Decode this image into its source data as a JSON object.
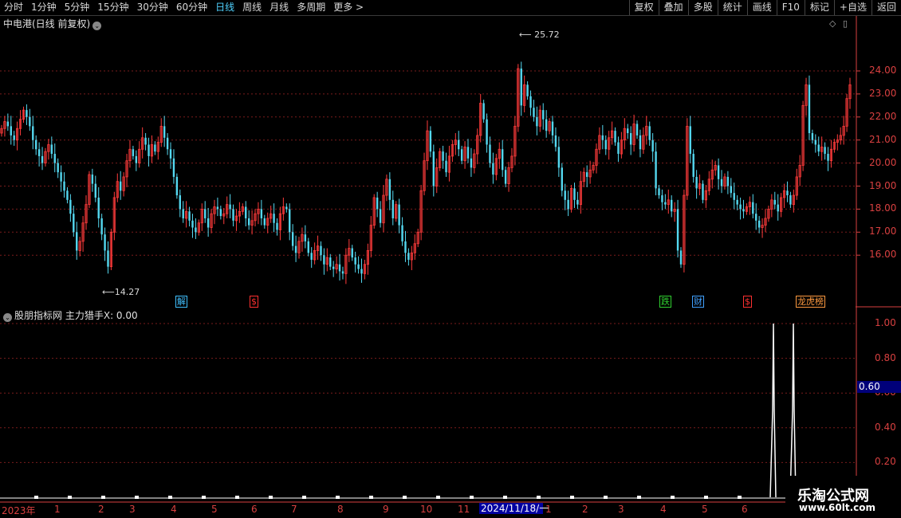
{
  "toolbar": {
    "periods": [
      "分时",
      "1分钟",
      "5分钟",
      "15分钟",
      "30分钟",
      "60分钟",
      "日线",
      "周线",
      "月线",
      "多周期",
      "更多 >"
    ],
    "active_period": "日线",
    "actions": [
      "复权",
      "叠加",
      "多股",
      "统计",
      "画线",
      "F10",
      "标记",
      "+自选",
      "返回"
    ]
  },
  "main_chart": {
    "title": "中电港(日线 前复权)",
    "high_label": "25.72",
    "low_label": "14.27",
    "y_axis": [
      "24.00",
      "23.00",
      "22.00",
      "21.00",
      "20.00",
      "19.00",
      "18.00",
      "17.00",
      "16.00"
    ],
    "markers": [
      {
        "text": "解",
        "color": "#40c0ff"
      },
      {
        "text": "$",
        "color": "#ff3030"
      },
      {
        "text": "跌",
        "color": "#30d030"
      },
      {
        "text": "财",
        "color": "#40a0ff"
      },
      {
        "text": "$",
        "color": "#ff3030"
      },
      {
        "text": "龙虎榜",
        "color": "#ff9a40"
      }
    ]
  },
  "sub_chart": {
    "title": "股朋指标网",
    "indicator": "主力猎手X: 0.00",
    "y_axis": [
      "1.00",
      "0.80",
      "0.60",
      "0.40",
      "0.20"
    ],
    "cursor_value": "0.60"
  },
  "x_axis": {
    "labels": [
      "2023年",
      "1",
      "2",
      "3",
      "4",
      "5",
      "6",
      "7",
      "8",
      "9",
      "10",
      "11",
      "1",
      "2",
      "3",
      "4",
      "5",
      "6"
    ],
    "highlight": "2024/11/18/一"
  },
  "watermark": {
    "line1": "乐淘公式网",
    "line2": "www.60lt.com"
  },
  "chart_data": {
    "type": "candlestick",
    "title": "中电港(日线 前复权)",
    "ylim": [
      14.27,
      25.72
    ],
    "y_ticks": [
      16,
      17,
      18,
      19,
      20,
      21,
      22,
      23,
      24
    ],
    "closes": [
      21.5,
      21.8,
      21.6,
      21.2,
      21.0,
      21.5,
      21.9,
      22.3,
      22.0,
      21.6,
      21.0,
      20.6,
      20.3,
      20.0,
      20.5,
      20.8,
      20.4,
      20.0,
      19.6,
      19.2,
      18.8,
      18.4,
      17.8,
      17.0,
      16.2,
      16.6,
      17.4,
      18.2,
      19.5,
      19.1,
      18.5,
      17.6,
      16.9,
      16.2,
      15.5,
      17.0,
      18.5,
      19.2,
      18.8,
      19.4,
      20.1,
      20.6,
      20.3,
      20.0,
      20.6,
      21.1,
      20.8,
      20.3,
      20.8,
      20.5,
      20.9,
      21.6,
      21.1,
      20.6,
      20.2,
      19.4,
      18.6,
      18.0,
      17.6,
      17.9,
      17.5,
      17.2,
      17.0,
      17.4,
      18.0,
      17.6,
      17.2,
      17.8,
      18.1,
      18.0,
      17.7,
      17.8,
      18.2,
      18.0,
      17.5,
      17.7,
      17.9,
      18.1,
      17.6,
      17.3,
      17.5,
      17.8,
      18.0,
      17.6,
      17.3,
      17.6,
      17.8,
      17.4,
      17.1,
      17.8,
      18.1,
      18.0,
      17.0,
      16.4,
      16.1,
      16.6,
      16.9,
      16.6,
      16.1,
      15.8,
      16.2,
      16.4,
      16.0,
      15.6,
      15.9,
      15.5,
      15.4,
      15.6,
      15.3,
      15.2,
      16.0,
      16.3,
      15.9,
      15.6,
      15.4,
      15.2,
      15.6,
      16.2,
      17.3,
      18.5,
      18.0,
      17.4,
      18.6,
      19.3,
      18.4,
      17.6,
      18.2,
      17.3,
      16.6,
      16.1,
      15.8,
      16.1,
      16.5,
      17.0,
      18.8,
      20.1,
      21.4,
      20.5,
      19.0,
      19.8,
      20.5,
      20.1,
      19.6,
      20.3,
      20.8,
      21.0,
      20.6,
      20.1,
      20.7,
      20.2,
      19.8,
      20.4,
      21.2,
      22.6,
      21.9,
      20.8,
      20.0,
      19.5,
      20.2,
      20.6,
      19.7,
      19.1,
      19.8,
      20.3,
      21.6,
      24.1,
      22.5,
      23.4,
      22.9,
      22.4,
      22.0,
      21.6,
      22.3,
      21.9,
      21.4,
      21.8,
      21.2,
      20.7,
      19.8,
      18.8,
      18.4,
      18.0,
      18.9,
      18.4,
      18.2,
      19.2,
      19.6,
      19.4,
      19.7,
      19.9,
      20.6,
      21.2,
      21.0,
      20.6,
      21.1,
      21.4,
      20.9,
      20.4,
      21.0,
      21.5,
      21.3,
      20.8,
      21.7,
      21.2,
      20.6,
      21.2,
      21.6,
      21.0,
      20.5,
      18.9,
      18.6,
      18.3,
      18.2,
      18.4,
      17.9,
      18.0,
      16.2,
      15.6,
      18.6,
      21.6,
      20.4,
      19.4,
      18.9,
      19.1,
      18.4,
      18.8,
      19.3,
      19.7,
      19.9,
      19.3,
      19.0,
      19.4,
      19.0,
      18.7,
      18.4,
      18.2,
      18.0,
      17.9,
      18.1,
      18.3,
      17.8,
      17.5,
      17.2,
      17.3,
      17.6,
      18.0,
      18.4,
      18.2,
      17.9,
      18.5,
      18.8,
      18.6,
      18.2,
      18.6,
      19.4,
      19.9,
      22.5,
      23.4,
      21.3,
      21.0,
      20.8,
      20.5,
      20.7,
      20.4,
      20.1,
      20.6,
      20.9,
      21.0,
      21.2,
      21.6,
      22.8,
      23.4
    ]
  },
  "sub_chart_data": {
    "type": "line",
    "ylim": [
      0,
      1
    ],
    "spikes": [
      {
        "position": 0.97,
        "value": 1.0
      },
      {
        "position": 0.995,
        "value": 1.0
      }
    ]
  }
}
